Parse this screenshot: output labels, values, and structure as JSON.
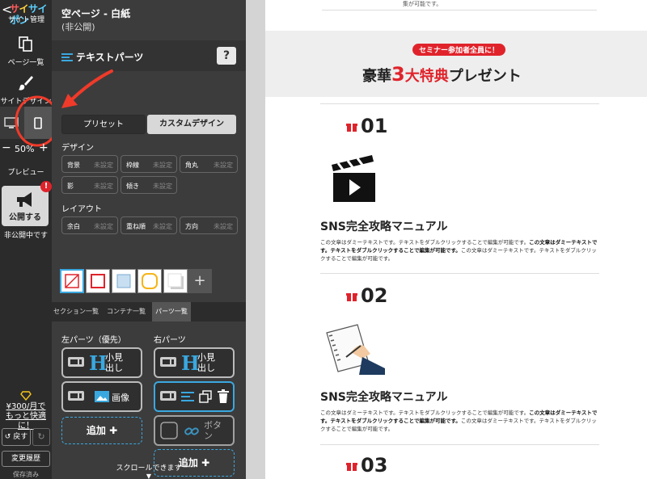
{
  "sidebar": {
    "back_symbol": "<",
    "logo": "サイポン",
    "logo_sub": "サイト管理",
    "pages_label": "ページ一覧",
    "design_label": "サイトデザイン",
    "zoom_minus": "−",
    "zoom_value": "50%",
    "zoom_plus": "+",
    "preview_label": "プレビュー",
    "publish_label": "公開する",
    "publish_badge": "!",
    "publish_status": "非公開中です",
    "upgrade_line1": "¥300/月で",
    "upgrade_line2": "もっと快適に！",
    "undo_label": "戻す",
    "redo_symbol": "↻",
    "history_label": "変更履歴",
    "saved_label": "保存済み"
  },
  "panel": {
    "page_title": "空ページ - 白紙",
    "page_status": "(非公開)",
    "parts_name": "テキストパーツ",
    "help": "?",
    "seg_preset": "プリセット",
    "seg_custom": "カスタムデザイン",
    "design_group": "デザイン",
    "layout_group": "レイアウト",
    "unset": "未設定",
    "design_chips": [
      "背景",
      "枠線",
      "角丸",
      "影",
      "傾き"
    ],
    "layout_chips": [
      "余白",
      "重ね順",
      "方向"
    ],
    "add_symbol": "+",
    "tabs": [
      "セクション一覧",
      "コンテナ一覧",
      "パーツ一覧"
    ],
    "left_col": "左パーツ（優先）",
    "right_col": "右パーツ",
    "h_letter": "H",
    "heading_label_1": "小見",
    "heading_label_2": "出し",
    "image_label": "画像",
    "button_label_1": "ボタ",
    "button_label_2": "ン",
    "add_label": "追加",
    "add_plus": "✚",
    "scroll_hint": "スクロールできます"
  },
  "canvas": {
    "header_fragment": "集が可能です。",
    "pill": "セミナー参加者全員に！",
    "headline_pre": "豪華",
    "headline_num": "3",
    "headline_mid": "大特典",
    "headline_post": "プレゼント",
    "items": [
      {
        "num": "01",
        "title": "SNS完全攻略マニュアル",
        "body_a": "この文章はダミーテキストです。テキストをダブルクリックすることで編集が可能です。",
        "body_b": "この文章はダミーテキストです。テキストをダブルクリックすることで編集が可能です。",
        "body_c": "この文章はダミーテキストです。テキストをダブルクリックすることで編集が可能です。"
      },
      {
        "num": "02",
        "title": "SNS完全攻略マニュアル",
        "body_a": "この文章はダミーテキストです。テキストをダブルクリックすることで編集が可能です。",
        "body_b": "この文章はダミーテキストです。テキストをダブルクリックすることで編集が可能です。",
        "body_c": "この文章はダミーテキストです。テキストをダブルクリックすることで編集が可能です。"
      },
      {
        "num": "03"
      }
    ]
  },
  "colors": {
    "accent_red": "#e0232b",
    "accent_blue": "#3aa8e0",
    "sidebar_bg": "#2b2b2b",
    "panel_bg": "#3c3c3c"
  },
  "icons": [
    "chevron-left-icon",
    "pages-icon",
    "brush-icon",
    "desktop-icon",
    "smartphone-icon",
    "megaphone-icon",
    "diamond-icon",
    "text-lines-icon",
    "gift-icon",
    "clapperboard-icon",
    "notebook-pen-icon",
    "image-icon",
    "copy-icon",
    "trash-icon",
    "link-icon"
  ]
}
